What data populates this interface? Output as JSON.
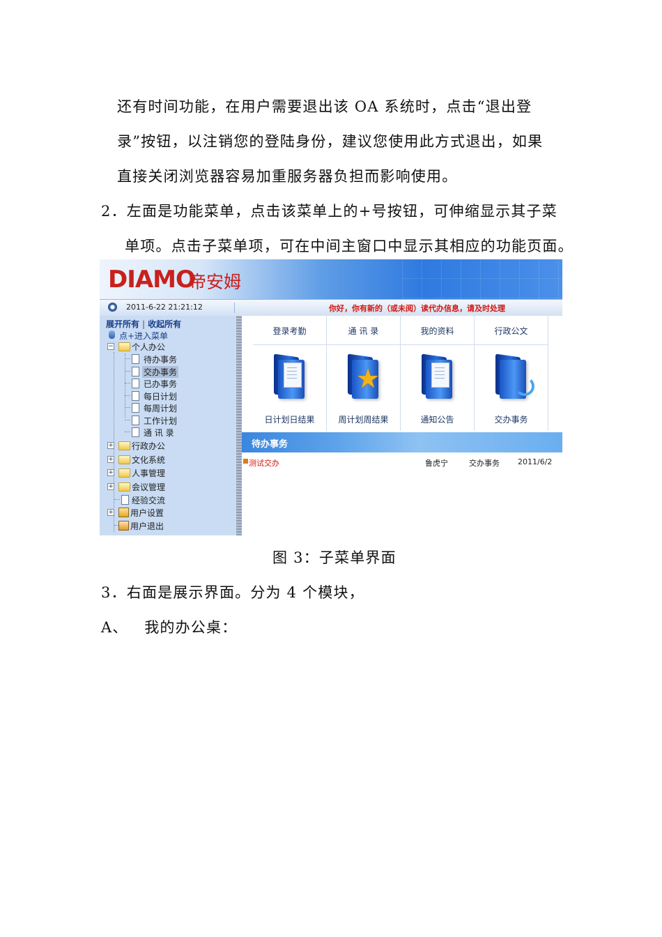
{
  "paragraphs": [
    "还有时间功能，在用户需要退出该 OA 系统时，点击“退出登",
    "录”按钮，以注销您的登陆身份，建议您使用此方式退出，如果",
    "直接关闭浏览器容易加重服务器负担而影响使用。",
    "2．左面是功能菜单，点击该菜单上的+号按钮，可伸缩显示其子菜",
    "单项。点击子菜单项，可在中间主窗口中显示其相应的功能页面。"
  ],
  "figure": {
    "logo_en": "DIAMO",
    "logo_cn": "帝安姆",
    "datetime": "2011-6-22 21:21:12",
    "notice": "你好，你有新的（或未阅）读代办信息，请及时处理",
    "sidebar": {
      "expand_all": "展开所有",
      "separator": "|",
      "collapse_all": "收起所有",
      "menu_title": "点+进入菜单",
      "tree": {
        "personal_office": "个人办公",
        "children": [
          "待办事务",
          "交办事务",
          "已办事务",
          "每日计划",
          "每周计划",
          "工作计划",
          "通 讯 录"
        ],
        "administration": "行政办公",
        "culture": "文化系统",
        "hr": "人事管理",
        "meeting": "会议管理",
        "experience": "经验交流",
        "user_settings": "用户设置",
        "logout": "用户退出"
      }
    },
    "tiles": [
      {
        "head": "登录考勤",
        "foot": "日计划日结果"
      },
      {
        "head": "通 讯 录",
        "foot": "周计划周结果"
      },
      {
        "head": "我的资料",
        "foot": "通知公告"
      },
      {
        "head": "行政公文",
        "foot": "交办事务"
      }
    ],
    "todo": {
      "title": "待办事务",
      "subject": "测试交办",
      "user": "鲁虎宁",
      "type": "交办事务",
      "date": "2011/6/2"
    }
  },
  "caption": "图 3：子菜单界面",
  "after": [
    "3．右面是展示界面。分为 4 个模块，",
    "A、   我的办公桌："
  ]
}
